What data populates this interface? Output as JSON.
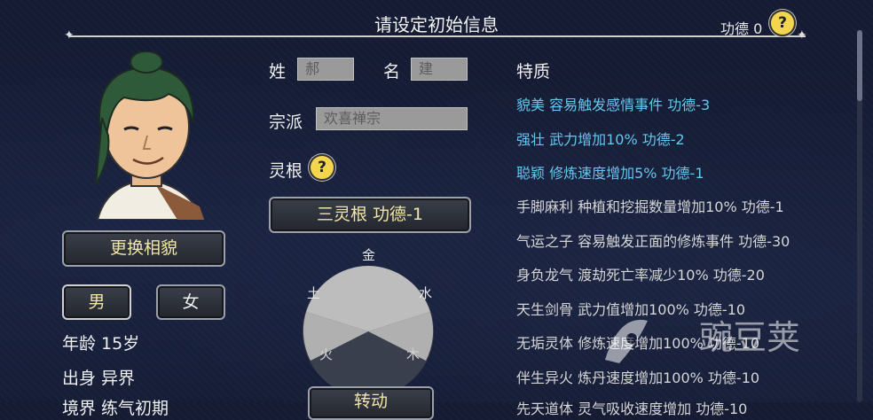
{
  "header": {
    "title": "请设定初始信息",
    "merit_label": "功德 0",
    "help_icon": "?"
  },
  "profile": {
    "change_face_button": "更换相貌",
    "gender": {
      "male": "男",
      "female": "女"
    },
    "age": "年龄 15岁",
    "origin": "出身 异界",
    "cut_off_line": "境界 练气初期"
  },
  "form": {
    "surname_label": "姓",
    "surname_value": "郝",
    "given_name_label": "名",
    "given_name_value": "建",
    "sect_label": "宗派",
    "sect_value": "欢喜禅宗",
    "root_label": "灵根",
    "root_help_icon": "?",
    "root_button": "三灵根 功德-1",
    "elements": {
      "metal": "金",
      "earth": "土",
      "water": "水",
      "fire": "火",
      "wood": "木"
    },
    "spin_button": "转动"
  },
  "traits": {
    "title": "特质",
    "items": [
      {
        "text": "貌美 容易触发感情事件 功德-3",
        "selected": true
      },
      {
        "text": "强壮 武力增加10% 功德-2",
        "selected": true
      },
      {
        "text": "聪颖 修炼速度增加5% 功德-1",
        "selected": true
      },
      {
        "text": "手脚麻利 种植和挖掘数量增加10% 功德-1",
        "selected": false
      },
      {
        "text": "气运之子 容易触发正面的修炼事件 功德-30",
        "selected": false
      },
      {
        "text": "身负龙气 渡劫死亡率减少10% 功德-20",
        "selected": false
      },
      {
        "text": "天生剑骨 武力值增加100% 功德-10",
        "selected": false
      },
      {
        "text": "无垢灵体 修炼速度增加100% 功德-10",
        "selected": false
      },
      {
        "text": "伴生异火 炼丹速度增加100% 功德-10",
        "selected": false
      },
      {
        "text": "先天道体 灵气吸收速度增加 功德-10",
        "selected": false
      }
    ]
  },
  "watermark": {
    "text": "豌豆荚"
  },
  "colors": {
    "selected_trait": "#63c7ef",
    "button_gold": "#f0e6a8",
    "help_yellow": "#f3d54e"
  }
}
